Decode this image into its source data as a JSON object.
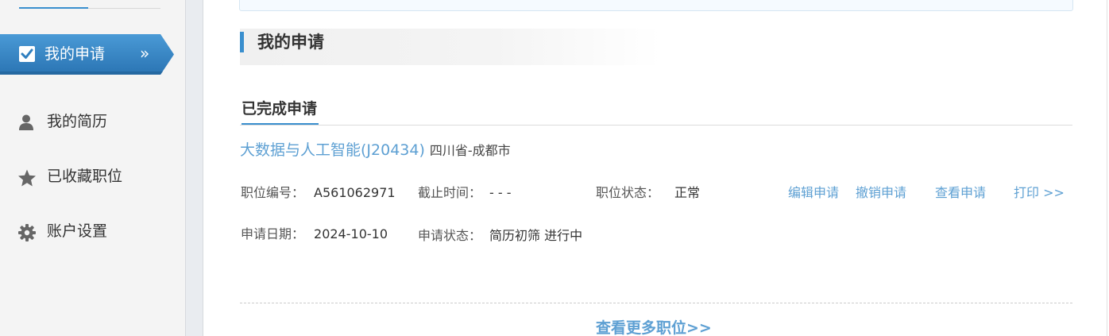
{
  "sidebar": {
    "active_item": {
      "label": "我的申请",
      "arrow": "»",
      "icon": "checkbox-icon"
    },
    "items": [
      {
        "label": "我的简历",
        "icon": "user-icon"
      },
      {
        "label": "已收藏职位",
        "icon": "star-icon"
      },
      {
        "label": "账户设置",
        "icon": "gear-icon"
      }
    ]
  },
  "main": {
    "section_title": "我的申请",
    "tab_label": "已完成申请",
    "application": {
      "job_title": "大数据与人工智能(J20434)",
      "location": "四川省-成都市",
      "job_id_label": "职位编号：",
      "job_id": "A561062971",
      "deadline_label": "截止时间：",
      "deadline": "- - -",
      "job_status_label": "职位状态：",
      "job_status": "正常",
      "apply_date_label": "申请日期：",
      "apply_date": "2024-10-10",
      "apply_status_label": "申请状态：",
      "apply_status": "简历初筛 进行中",
      "actions": {
        "edit": "编辑申请",
        "withdraw": "撤销申请",
        "view": "查看申请",
        "print": "打印 >>"
      }
    },
    "more_link": "查看更多职位>>"
  },
  "colors": {
    "accent": "#3a8fce",
    "link": "#5ea0d3",
    "sidebar_bg": "#f4f4f4",
    "active_nav_bg": "#2f7fbf"
  }
}
